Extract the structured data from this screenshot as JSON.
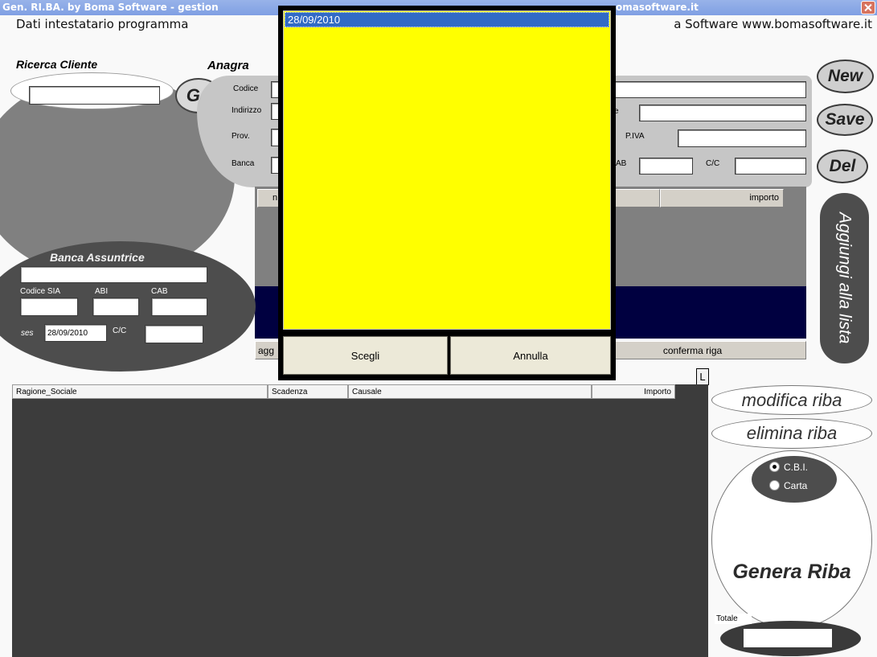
{
  "window": {
    "title_left": "Gen. RI.BA. by Boma Software - gestion",
    "title_right": "omasoftware.it",
    "close_icon": "close-icon"
  },
  "header": {
    "left": "Dati intestatario programma",
    "right": "a Software www.bomasoftware.it"
  },
  "search": {
    "label": "Ricerca Cliente",
    "go_label": "Go"
  },
  "anagrafica": {
    "title": "Anagra",
    "codice_label": "Codice",
    "indirizzo_label": "Indirizzo",
    "prov_label": "Prov.",
    "banca_label": "Banca",
    "row2_right_label": "e",
    "piva_label": "P.IVA",
    "cab_label": "AB",
    "cc_label": "C/C"
  },
  "actions": {
    "new_label": "New",
    "save_label": "Save",
    "delete_label": "Del",
    "add_to_list_label": "Aggiungi alla lista"
  },
  "rows_editor": {
    "first_header": "n",
    "amount_header": "importo",
    "add_label": "agg",
    "confirm_label": "conferma riga"
  },
  "banca_assuntrice": {
    "title": "Banca Assuntrice",
    "codice_sia_label": "Codice SIA",
    "abi_label": "ABI",
    "cab_label": "CAB",
    "date_label": "ses",
    "date_value": "28/09/2010",
    "cc_label": "C/C"
  },
  "table": {
    "toggle_label": "L",
    "columns": [
      "Ragione_Sociale",
      "Scadenza",
      "Causale",
      "Importo"
    ],
    "rows": []
  },
  "riba": {
    "modify_label": "modifica riba",
    "delete_label": "elimina riba",
    "formats": [
      {
        "label": "C.B.I.",
        "selected": true
      },
      {
        "label": "Carta",
        "selected": false
      }
    ],
    "generate_label": "Genera Riba",
    "total_label": "Totale"
  },
  "popup": {
    "items": [
      {
        "label": "28/09/2010",
        "selected": true
      }
    ],
    "choose_label": "Scegli",
    "cancel_label": "Annulla"
  },
  "colors": {
    "title_bar": "#98b3e9",
    "panel_light": "#c6c6c6",
    "panel_mid": "#808080",
    "panel_dark": "#4d4d4d",
    "navy_band": "#000040",
    "popup_list": "#ffff00",
    "selection": "#316ac5",
    "table_bg": "#3c3c3c",
    "button_face": "#ece9d8"
  }
}
